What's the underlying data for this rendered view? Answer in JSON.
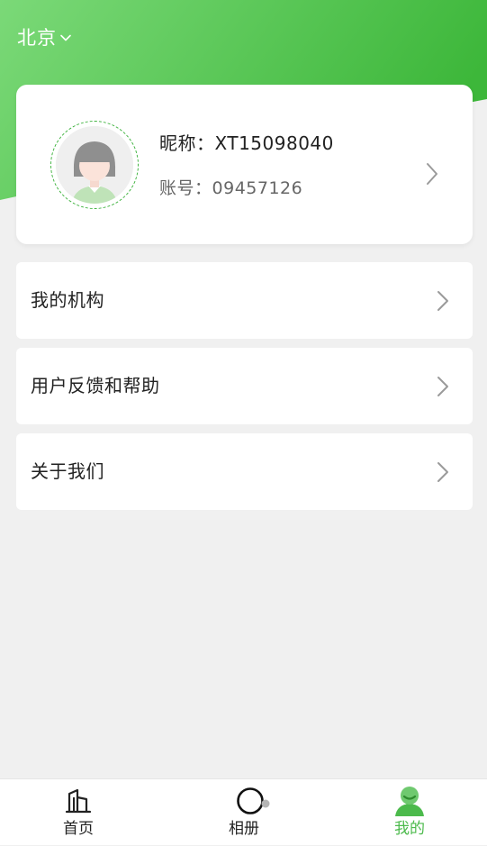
{
  "header": {
    "location": "北京"
  },
  "profile": {
    "nickname_label": "昵称：",
    "nickname_value": "XT15098040",
    "account_label": "账号：",
    "account_value": "09457126"
  },
  "menu": {
    "items": [
      {
        "label": "我的机构",
        "icon": "chevron-right-icon"
      },
      {
        "label": "用户反馈和帮助",
        "icon": "chevron-right-icon"
      },
      {
        "label": "关于我们",
        "icon": "chevron-right-icon"
      }
    ]
  },
  "tabbar": {
    "tabs": [
      {
        "label": "首页",
        "icon": "building-icon",
        "active": false
      },
      {
        "label": "相册",
        "icon": "camera-ring-icon",
        "active": false
      },
      {
        "label": "我的",
        "icon": "user-icon",
        "active": true
      }
    ]
  },
  "colors": {
    "accent": "#4cba4c",
    "header_light": "#7ad87a",
    "header_dark": "#3cb83c",
    "background": "#f0f0f0"
  }
}
